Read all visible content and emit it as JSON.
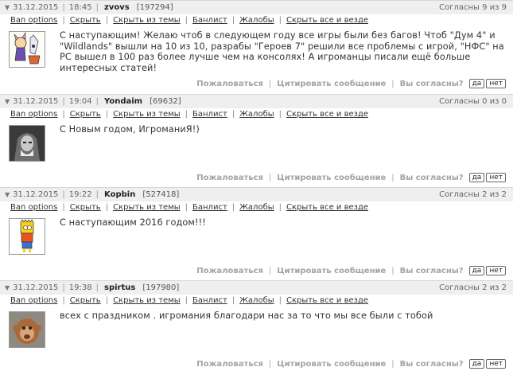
{
  "link_labels": {
    "ban": "Ban options",
    "hide": "Скрыть",
    "hide_topic": "Скрыть из темы",
    "banlist": "Банлист",
    "complaints": "Жалобы",
    "hide_all": "Скрыть все и везде"
  },
  "action_labels": {
    "complain": "Пожаловаться",
    "quote": "Цитировать сообщение",
    "agree_q": "Вы согласны?",
    "yes": "да",
    "no": "нет"
  },
  "comments": [
    {
      "date": "31.12.2015",
      "time": "18:45",
      "user": "zvovs",
      "uid": "[197294]",
      "agree": "Согласны 9 из 9",
      "text": "С наступающим! Желаю чтоб в следующем году все игры были без багов! Чтоб \"Дум 4\" и \"Wildlands\" вышли на 10 из 10, разрабы \"Героев 7\" решили все проблемы с игрой, \"НФС\" на PC вышел в 100 раз более лучше чем на консолях! А игроманцы писали ещё больше интересных статей!"
    },
    {
      "date": "31.12.2015",
      "time": "19:04",
      "user": "Yondaim",
      "uid": "[69632]",
      "agree": "Согласны 0 из 0",
      "text": "С Новым годом, ИгроманиЯ!)"
    },
    {
      "date": "31.12.2015",
      "time": "19:22",
      "user": "Kopbin",
      "uid": "[527418]",
      "agree": "Согласны 2 из 2",
      "text": "С наступающим 2016 годом!!!"
    },
    {
      "date": "31.12.2015",
      "time": "19:38",
      "user": "spirtus",
      "uid": "[197980]",
      "agree": "Согласны 2 из 2",
      "text": "всех с праздником . игромания благодари нас за то что мы все были с тобой"
    }
  ]
}
